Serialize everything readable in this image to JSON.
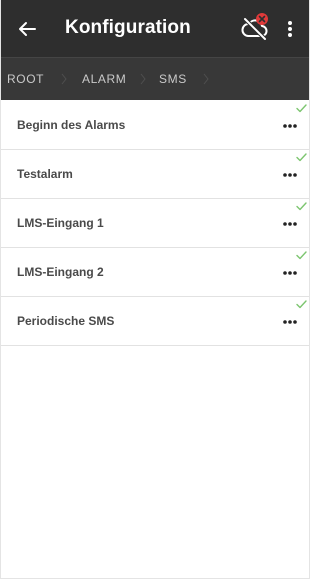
{
  "appbar": {
    "title": "Konfiguration",
    "back_icon": "arrow-left-icon",
    "status_icon": "cloud-off-icon",
    "status_badge_icon": "error-x-icon",
    "menu_icon": "more-vertical-icon"
  },
  "breadcrumb": [
    {
      "label": "ROOT"
    },
    {
      "label": "ALARM"
    },
    {
      "label": "SMS"
    }
  ],
  "items": [
    {
      "label": "Beginn des Alarms",
      "status": "check-icon",
      "action": "more-horizontal-icon"
    },
    {
      "label": "Testalarm",
      "status": "check-icon",
      "action": "more-horizontal-icon"
    },
    {
      "label": "LMS-Eingang 1",
      "status": "check-icon",
      "action": "more-horizontal-icon"
    },
    {
      "label": "LMS-Eingang 2",
      "status": "check-icon",
      "action": "more-horizontal-icon"
    },
    {
      "label": "Periodische SMS",
      "status": "check-icon",
      "action": "more-horizontal-icon"
    }
  ],
  "colors": {
    "appbar": "#2e2e2e",
    "breadcrumb_bar": "#383838",
    "check": "#7cc56f",
    "error_badge": "#e03a3a",
    "label_text": "#4a4a4a"
  }
}
